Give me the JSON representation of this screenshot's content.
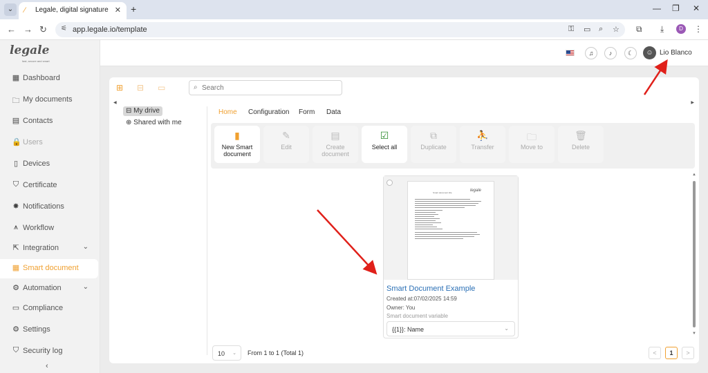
{
  "browser": {
    "tab_title": "Legale, digital signature",
    "url": "app.legale.io/template",
    "profile_initial": "D"
  },
  "app": {
    "logo_text": "legale",
    "logo_tagline": "fast, secure and smart",
    "user_name": "Lio Blanco",
    "nav": [
      {
        "label": "Dashboard",
        "icon": "▦",
        "name": "dashboard"
      },
      {
        "label": "My documents",
        "icon": "🗀",
        "name": "my-documents"
      },
      {
        "label": "Contacts",
        "icon": "▤",
        "name": "contacts"
      },
      {
        "label": "Users",
        "icon": "🔒",
        "name": "users",
        "disabled": true
      },
      {
        "label": "Devices",
        "icon": "▯",
        "name": "devices"
      },
      {
        "label": "Certificate",
        "icon": "⛉",
        "name": "certificate"
      },
      {
        "label": "Notifications",
        "icon": "✸",
        "name": "notifications"
      },
      {
        "label": "Workflow",
        "icon": "⩚",
        "name": "workflow"
      },
      {
        "label": "Integration",
        "icon": "⇱",
        "name": "integration",
        "chevron": "⌄"
      },
      {
        "label": "Smart document",
        "icon": "▦",
        "name": "smart-document",
        "active": true
      },
      {
        "label": "Automation",
        "icon": "⚙",
        "name": "automation",
        "chevron": "⌄"
      },
      {
        "label": "Compliance",
        "icon": "▭",
        "name": "compliance"
      },
      {
        "label": "Settings",
        "icon": "⚙",
        "name": "settings"
      },
      {
        "label": "Security log",
        "icon": "⛉",
        "name": "security-log"
      }
    ]
  },
  "search": {
    "placeholder": "Search"
  },
  "tree": {
    "my_drive": "My drive",
    "shared": "Shared with me"
  },
  "tabs": [
    "Home",
    "Configuration",
    "Form",
    "Data"
  ],
  "toolbar": [
    {
      "label": "New Smart document",
      "icon": "▮",
      "enabled": true,
      "name": "new-smart-document"
    },
    {
      "label": "Edit",
      "icon": "✎",
      "enabled": false,
      "name": "edit"
    },
    {
      "label": "Create document",
      "icon": "▤",
      "enabled": false,
      "name": "create-document"
    },
    {
      "label": "Select all",
      "icon": "☑",
      "enabled": true,
      "name": "select-all"
    },
    {
      "label": "Duplicate",
      "icon": "⧉",
      "enabled": false,
      "name": "duplicate"
    },
    {
      "label": "Transfer",
      "icon": "⛹",
      "enabled": false,
      "name": "transfer"
    },
    {
      "label": "Move to",
      "icon": "🗀",
      "enabled": false,
      "name": "move-to"
    },
    {
      "label": "Delete",
      "icon": "🗑",
      "enabled": false,
      "name": "delete"
    }
  ],
  "card": {
    "title": "Smart Document Example",
    "created": "Created at:07/02/2025 14:59",
    "owner": "Owner: You",
    "variable_label": "Smart document variable",
    "variable_value": "{{1}}: Name",
    "page_title": "Smart document title",
    "page_logo": "legale"
  },
  "pagination": {
    "page_size": "10",
    "range": "From 1 to 1 (Total 1)",
    "prev": "<",
    "current": "1",
    "next": ">"
  },
  "colors": {
    "accent": "#f0a030",
    "link": "#2a6fb5",
    "annotation_arrow": "#e0201a"
  }
}
